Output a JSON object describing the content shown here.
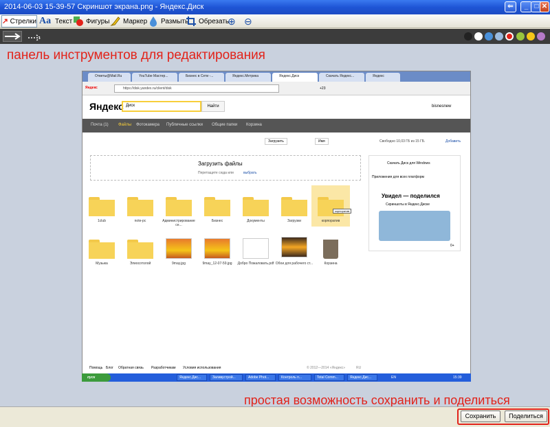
{
  "window": {
    "title": "2014-06-03 15-39-57 Скриншот экрана.png - Яндекс.Диск",
    "buttons": {
      "back": "⇐",
      "min": "_",
      "max": "□",
      "close": "✕"
    }
  },
  "toolbar": {
    "tools": [
      {
        "label": "Стрелки",
        "icon": "arrow-icon"
      },
      {
        "label": "Текст",
        "icon": "text-icon"
      },
      {
        "label": "Фигуры",
        "icon": "shapes-icon"
      },
      {
        "label": "Маркер",
        "icon": "marker-icon"
      },
      {
        "label": "Размыть",
        "icon": "blur-icon"
      },
      {
        "label": "Обрезать",
        "icon": "crop-icon"
      }
    ],
    "zoom_in": "⊕",
    "zoom_out": "⊖"
  },
  "colors": [
    "#222222",
    "#ffffff",
    "#4a90d9",
    "#9bbbe0",
    "#e2231a",
    "#9ac43e",
    "#f5c518",
    "#b57ac7"
  ],
  "annotations": {
    "top": "панель инструментов для редактирования",
    "bottom": "простая возможность сохранить и поделиться"
  },
  "screenshot": {
    "tabs": [
      "Ответы@Mail.Ru",
      "YouTube Мастер...",
      "Бизнес в Сети -...",
      "Яндекс.Метрика",
      "Яндекс.Диск",
      "Скачать Яндекс...",
      "Яндекс"
    ],
    "url": "https://disk.yandex.ru/client/disk",
    "addr_extra": "+23",
    "logo": "Яндекс",
    "search_value": "Диск",
    "find_button": "Найти",
    "username": "bisnesnew",
    "nav": [
      "Почта (1)",
      "Файлы",
      "Фотокамера",
      "Публичные ссылки",
      "Общие папки",
      "Корзина"
    ],
    "upload_btn": "Загрузить",
    "sort_btn": "Имя",
    "space": "Свободно 10,03 ГБ из 15 ГБ.",
    "add_space": "Добавить",
    "upload_title": "Загрузить файлы",
    "upload_hint": "Перетащите сюда или",
    "upload_link": "выбрать",
    "download_win": "Скачать Диск для Windows",
    "apps_all": "Приложения для всех платформ",
    "promo_title": "Увидел — поделился",
    "promo_sub": "Скриншоты в Яндекс.Диске",
    "promo_age": "0+",
    "folders": [
      "1club",
      "note-pc",
      "Администрирование се...",
      "Бизнес",
      "Документы",
      "Загрузки",
      "корпоратив"
    ],
    "tooltip": "корпоратив",
    "row2": [
      "Музыка",
      "Элиосотолой",
      "9may.jpg",
      "9may_12-07-59.jpg",
      "Добро Пожаловать.pdf",
      "Обои для рабочего ст...",
      "Корзина"
    ],
    "footer": [
      "Помощь",
      "Блог",
      "Обратная связь",
      "Разработчикам",
      "Условия использования"
    ],
    "copyright": "© 2012—2014 «Яндекс»",
    "lang": "RU"
  },
  "taskbar": {
    "start": "пуск",
    "tasks": [
      "Яндекс.Дис...",
      "Заливустрой...",
      "Adobe Phot...",
      "Контроль п...",
      "Total Comm...",
      "Яндекс.Дис..."
    ],
    "lang": "EN",
    "clock": "15:39"
  },
  "bottom": {
    "save": "Сохранить",
    "share": "Поделиться"
  }
}
